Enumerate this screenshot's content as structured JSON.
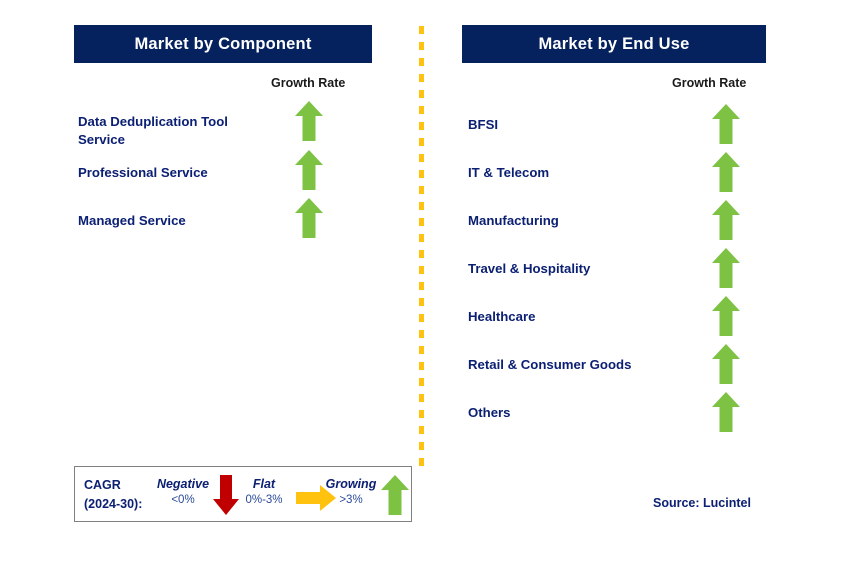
{
  "divider": {
    "color": "#ffc20e"
  },
  "theme": {
    "header_bg": "#06225e",
    "header_text": "#ffffff",
    "label_navy": "#0c2073",
    "growing_green": "#7dc242",
    "negative_red": "#c00000",
    "flat_yellow": "#ffc20e"
  },
  "panels": [
    {
      "key": "component",
      "title": "Market by Component",
      "growth_rate_caption": "Growth Rate",
      "rows": [
        {
          "label": "Data Deduplication Tool\nService",
          "trend": "growing",
          "icon": "arrow-up-icon"
        },
        {
          "label": "Professional Service",
          "trend": "growing",
          "icon": "arrow-up-icon"
        },
        {
          "label": "Managed Service",
          "trend": "growing",
          "icon": "arrow-up-icon"
        }
      ]
    },
    {
      "key": "end_use",
      "title": "Market by End Use",
      "growth_rate_caption": "Growth Rate",
      "rows": [
        {
          "label": "BFSI",
          "trend": "growing",
          "icon": "arrow-up-icon"
        },
        {
          "label": "IT & Telecom",
          "trend": "growing",
          "icon": "arrow-up-icon"
        },
        {
          "label": "Manufacturing",
          "trend": "growing",
          "icon": "arrow-up-icon"
        },
        {
          "label": "Travel & Hospitality",
          "trend": "growing",
          "icon": "arrow-up-icon"
        },
        {
          "label": "Healthcare",
          "trend": "growing",
          "icon": "arrow-up-icon"
        },
        {
          "label": "Retail & Consumer Goods",
          "trend": "growing",
          "icon": "arrow-up-icon"
        },
        {
          "label": "Others",
          "trend": "growing",
          "icon": "arrow-up-icon"
        }
      ]
    }
  ],
  "legend": {
    "title": "CAGR\n(2024-30):",
    "items": [
      {
        "name": "Negative",
        "range": "<0%",
        "icon": "arrow-down-icon",
        "color": "#c00000"
      },
      {
        "name": "Flat",
        "range": "0%-3%",
        "icon": "arrow-right-icon",
        "color": "#ffc20e"
      },
      {
        "name": "Growing",
        "range": ">3%",
        "icon": "arrow-up-icon",
        "color": "#7dc242"
      }
    ]
  },
  "source": "Source: Lucintel"
}
